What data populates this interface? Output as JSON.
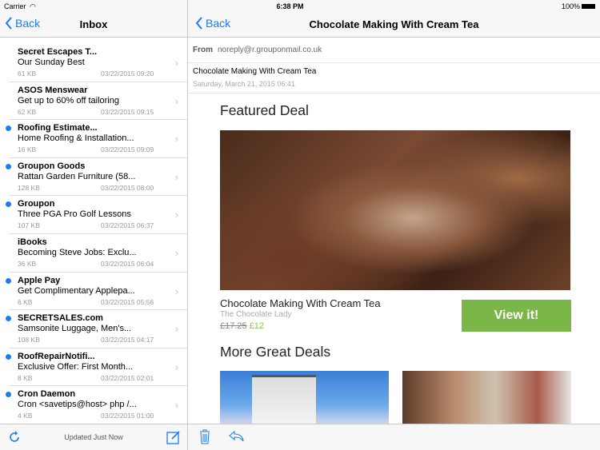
{
  "status": {
    "carrier": "Carrier",
    "time": "6:38 PM",
    "battery": "100%"
  },
  "inbox": {
    "back_label": "Back",
    "title": "Inbox",
    "updated": "Updated Just Now",
    "messages": [
      {
        "sender": "Secret Escapes T...",
        "subject": "Our Sunday Best",
        "size": "61 KB",
        "date": "03/22/2015 09:20",
        "unread": false
      },
      {
        "sender": "ASOS Menswear",
        "subject": "Get up to 60% off tailoring",
        "size": "62 KB",
        "date": "03/22/2015 09:15",
        "unread": false
      },
      {
        "sender": "Roofing Estimate...",
        "subject": "Home Roofing & Installation...",
        "size": "16 KB",
        "date": "03/22/2015 09:09",
        "unread": true
      },
      {
        "sender": "Groupon Goods",
        "subject": "Rattan Garden Furniture (58...",
        "size": "128 KB",
        "date": "03/22/2015 08:00",
        "unread": true
      },
      {
        "sender": "Groupon",
        "subject": "Three PGA Pro Golf Lessons",
        "size": "107 KB",
        "date": "03/22/2015 06:37",
        "unread": true
      },
      {
        "sender": "iBooks",
        "subject": "Becoming Steve Jobs: Exclu...",
        "size": "36 KB",
        "date": "03/22/2015 06:04",
        "unread": false
      },
      {
        "sender": "Apple Pay",
        "subject": "Get Complimentary Applepa...",
        "size": "6 KB",
        "date": "03/22/2015 05:56",
        "unread": true
      },
      {
        "sender": "SECRETSALES.com",
        "subject": "Samsonite Luggage, Men's...",
        "size": "108 KB",
        "date": "03/22/2015 04:17",
        "unread": true
      },
      {
        "sender": "RoofRepairNotifi...",
        "subject": "Exclusive Offer: First Month...",
        "size": "8 KB",
        "date": "03/22/2015 02:01",
        "unread": true
      },
      {
        "sender": "Cron Daemon",
        "subject": "Cron <savetips@host> php /...",
        "size": "4 KB",
        "date": "03/22/2015 01:00",
        "unread": true
      }
    ]
  },
  "message": {
    "back_label": "Back",
    "title": "Chocolate Making With Cream Tea",
    "from_label": "From",
    "from": "noreply@r.grouponmail.co.uk",
    "subject": "Chocolate Making With Cream Tea",
    "date": "Saturday, March 21, 2015 06:41",
    "featured_heading": "Featured Deal",
    "deal_title": "Chocolate Making With Cream Tea",
    "merchant": "The Chocolate Lady",
    "old_price": "£17.25",
    "new_price": "£12",
    "cta": "View it!",
    "more_heading": "More Great Deals"
  },
  "colors": {
    "accent": "#1a7cf5",
    "cta": "#7ab648",
    "price": "#8cc05a"
  }
}
